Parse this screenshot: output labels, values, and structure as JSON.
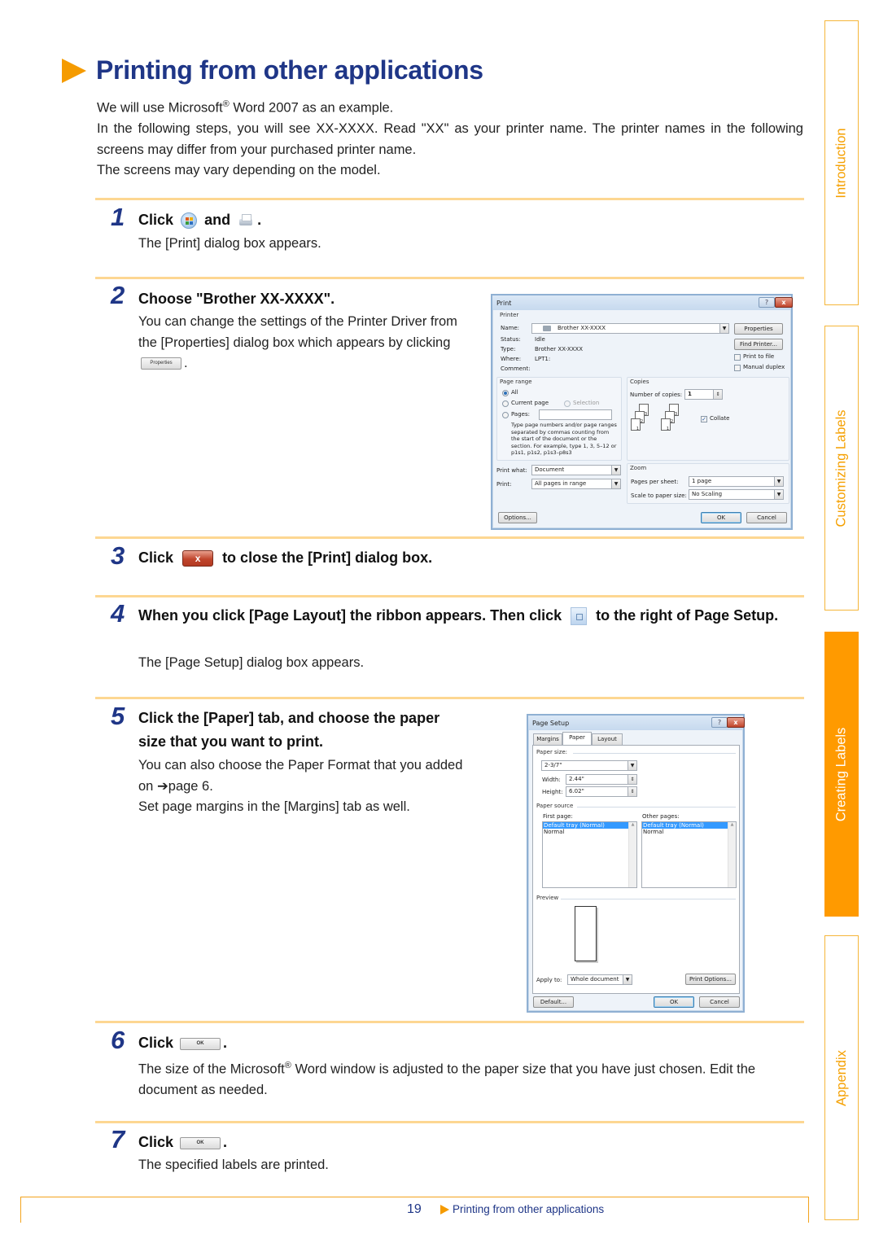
{
  "page": {
    "title": "Printing from other applications",
    "intro": {
      "line1_prefix": "We will use Microsoft",
      "line1_reg": "®",
      "line1_suffix": " Word 2007 as an example.",
      "line2": "In the following steps, you will see XX-XXXX. Read \"XX\" as your printer name. The printer names in the following screens may differ from your purchased printer name.",
      "line3": "The screens may vary depending on the model."
    }
  },
  "steps": [
    {
      "num": "1",
      "head_a": "Click",
      "head_b": "and",
      "head_c": ".",
      "icon_a": "office-button-icon",
      "icon_b": "print-icon",
      "body": "The [Print] dialog box appears."
    },
    {
      "num": "2",
      "head": "Choose \"Brother XX-XXXX\".",
      "body_a": "You can change the settings of the Printer Driver from the [Properties] dialog box which appears by clicking",
      "body_b": ".",
      "button_label": "Properties"
    },
    {
      "num": "3",
      "head_a": "Click",
      "head_b": "to close the [Print] dialog box.",
      "icon": "close-icon",
      "icon_glyph": "x"
    },
    {
      "num": "4",
      "head_a": "When you click [Page Layout] the ribbon appears. Then click",
      "head_b": "to the right of Page Setup.",
      "icon": "dialog-launcher-icon",
      "body": "The [Page Setup] dialog box appears."
    },
    {
      "num": "5",
      "head": "Click the [Paper] tab, and choose the paper size that you want to print.",
      "body_a": "You can also choose the Paper Format that you added on ",
      "arrow": "➔",
      "body_link": "page 6",
      "body_b": ".",
      "body_c": "Set page margins in the [Margins] tab as well."
    },
    {
      "num": "6",
      "head_a": "Click",
      "head_b": ".",
      "button_label": "OK",
      "body_prefix": "The size of the Microsoft",
      "body_reg": "®",
      "body_suffix": " Word window is adjusted to the paper size that you have just chosen. Edit the document as needed."
    },
    {
      "num": "7",
      "head_a": "Click",
      "head_b": ".",
      "button_label": "OK",
      "body": "The specified labels are printed."
    }
  ],
  "print_dialog": {
    "title": "Print",
    "help": "?",
    "close": "x",
    "printer_group": "Printer",
    "name_label": "Name:",
    "name_value": "Brother XX-XXXX",
    "status_label": "Status:",
    "status_value": "Idle",
    "type_label": "Type:",
    "type_value": "Brother XX-XXXX",
    "where_label": "Where:",
    "where_value": "LPT1:",
    "comment_label": "Comment:",
    "properties_btn": "Properties",
    "find_printer_btn": "Find Printer...",
    "print_to_file": "Print to file",
    "manual_duplex": "Manual duplex",
    "page_range_group": "Page range",
    "range_all": "All",
    "range_current": "Current page",
    "range_selection": "Selection",
    "range_pages": "Pages:",
    "range_hint": "Type page numbers and/or page ranges separated by commas counting from the start of the document or the section. For example, type 1, 3, 5–12 or p1s1, p1s2, p1s3–p8s3",
    "copies_group": "Copies",
    "num_copies_label": "Number of copies:",
    "num_copies_value": "1",
    "collate": "Collate",
    "collate_checked": true,
    "sheet_labels": [
      "1",
      "2",
      "3"
    ],
    "print_what_label": "Print what:",
    "print_what_value": "Document",
    "print_label": "Print:",
    "print_value": "All pages in range",
    "zoom_group": "Zoom",
    "pages_per_sheet_label": "Pages per sheet:",
    "pages_per_sheet_value": "1 page",
    "scale_label": "Scale to paper size:",
    "scale_value": "No Scaling",
    "options_btn": "Options...",
    "ok_btn": "OK",
    "cancel_btn": "Cancel"
  },
  "page_setup_dialog": {
    "title": "Page Setup",
    "help": "?",
    "close": "x",
    "tabs": [
      "Margins",
      "Paper",
      "Layout"
    ],
    "active_tab": "Paper",
    "paper_size_group": "Paper size:",
    "paper_size_value": "2-3/7\"",
    "width_label": "Width:",
    "width_value": "2.44\"",
    "height_label": "Height:",
    "height_value": "6.02\"",
    "paper_source_group": "Paper source",
    "first_page_label": "First page:",
    "other_pages_label": "Other pages:",
    "first_page_items": [
      "Default tray (Normal)",
      "Normal"
    ],
    "other_pages_items": [
      "Default tray (Normal)",
      "Normal"
    ],
    "preview_group": "Preview",
    "apply_to_label": "Apply to:",
    "apply_to_value": "Whole document",
    "print_options_btn": "Print Options...",
    "default_btn": "Default...",
    "ok_btn": "OK",
    "cancel_btn": "Cancel"
  },
  "side_tabs": [
    {
      "label": "Introduction",
      "active": false
    },
    {
      "label": "Customizing Labels",
      "active": false
    },
    {
      "label": "Creating Labels",
      "active": true
    },
    {
      "label": "Appendix",
      "active": false
    }
  ],
  "footer": {
    "page_number": "19",
    "link": "Printing from other applications"
  },
  "colors": {
    "accent_orange": "#f59b00",
    "title_blue": "#1f3687",
    "rule": "#fdd792",
    "active_tab": "#ff9a00"
  }
}
